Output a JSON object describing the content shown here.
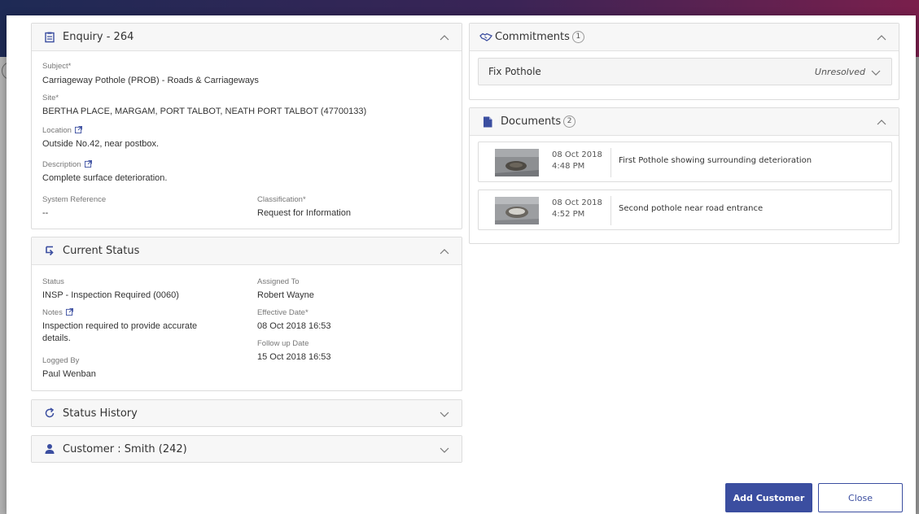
{
  "enquiry": {
    "title": "Enquiry - 264",
    "subject_label": "Subject*",
    "subject_value": "Carriageway Pothole (PROB) - Roads & Carriageways",
    "site_label": "Site*",
    "site_value": "BERTHA PLACE, MARGAM, PORT TALBOT, NEATH PORT TALBOT (47700133)",
    "location_label": "Location",
    "location_value": "Outside No.42, near postbox.",
    "description_label": "Description",
    "description_value": "Complete surface deterioration.",
    "sysref_label": "System Reference",
    "sysref_value": "--",
    "classification_label": "Classification*",
    "classification_value": "Request for Information"
  },
  "current_status": {
    "title": "Current Status",
    "status_label": "Status",
    "status_value": "INSP - Inspection Required (0060)",
    "notes_label": "Notes",
    "notes_line1": "Inspection required to provide accurate",
    "notes_line2": "details.",
    "logged_by_label": "Logged By",
    "logged_by_value": "Paul Wenban",
    "assigned_to_label": "Assigned To",
    "assigned_to_value": "Robert Wayne",
    "effective_date_label": "Effective Date*",
    "effective_date_value": "08 Oct 2018 16:53",
    "follow_up_label": "Follow up Date",
    "follow_up_value": "15 Oct 2018 16:53"
  },
  "status_history": {
    "title": "Status History"
  },
  "customer": {
    "title": "Customer : Smith (242)"
  },
  "commitments": {
    "title": "Commitments",
    "count": "1",
    "items": [
      {
        "title": "Fix Pothole",
        "status": "Unresolved"
      }
    ]
  },
  "documents": {
    "title": "Documents",
    "count": "2",
    "items": [
      {
        "date": "08 Oct 2018",
        "time": "4:48 PM",
        "description": "First Pothole showing surrounding deterioration"
      },
      {
        "date": "08 Oct 2018",
        "time": "4:52 PM",
        "description": "Second pothole near road entrance"
      }
    ]
  },
  "buttons": {
    "add_customer": "Add Customer",
    "close": "Close"
  },
  "colors": {
    "accent": "#3b4ea0",
    "header_bg": "#f7f7f7",
    "border": "#dcdcdc"
  }
}
